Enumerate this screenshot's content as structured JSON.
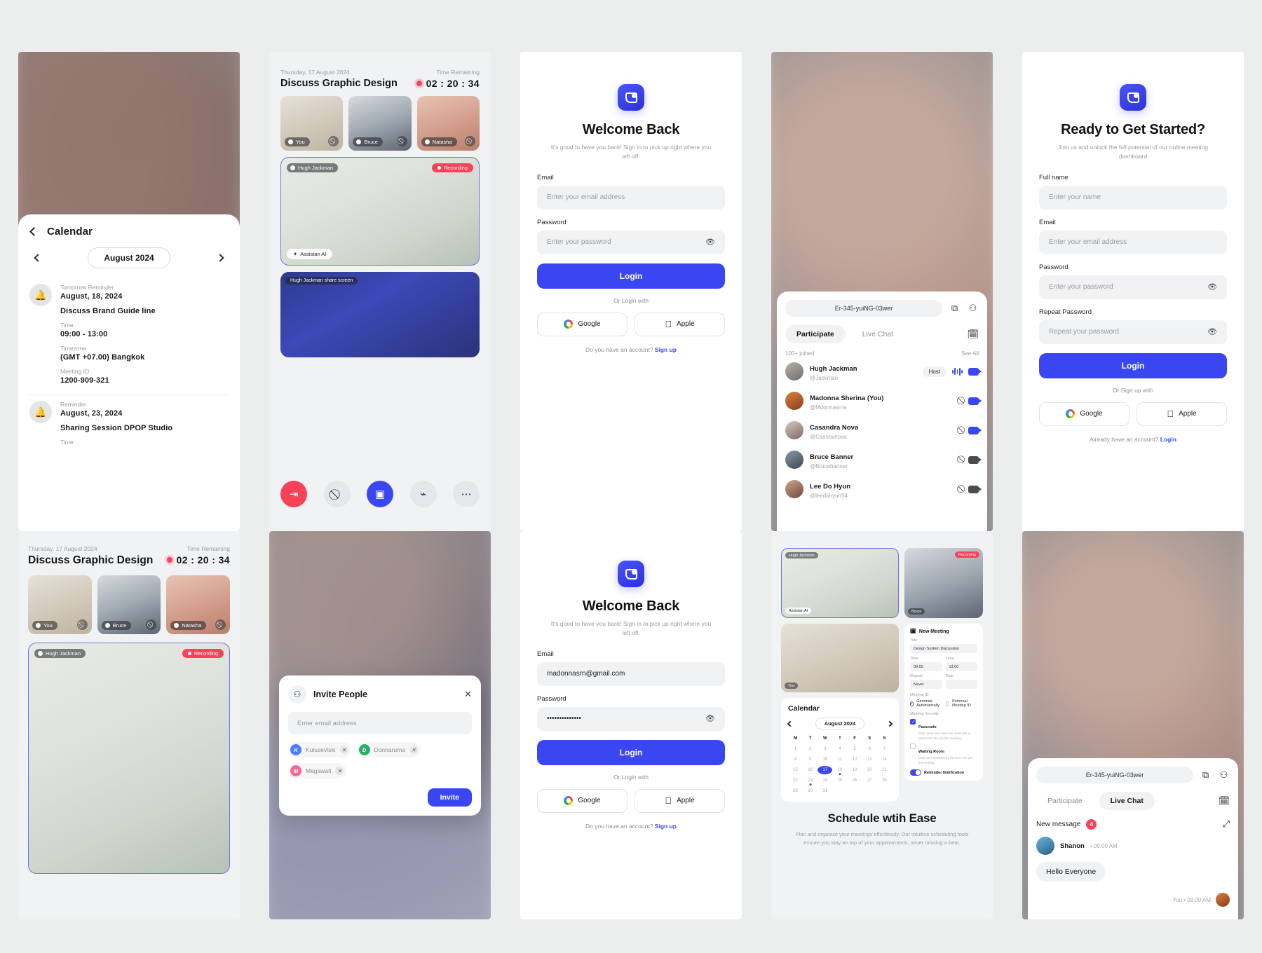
{
  "calendar_screen": {
    "back_label": "Calendar",
    "month": "August 2024",
    "events": [
      {
        "reminder_label": "Tomorrow Reminder",
        "date": "August, 18, 2024",
        "title": "Discuss Brand Guide line",
        "time_label": "Time",
        "time": "09:00 - 13:00",
        "tz_label": "Timezone",
        "tz": "(GMT +07.00) Bangkok",
        "id_label": "Meeting ID",
        "id": "1200-909-321"
      },
      {
        "reminder_label": "Reminder",
        "date": "August, 23, 2024",
        "title": "Sharing Session DPOP Studio",
        "time_label": "Time"
      }
    ]
  },
  "meeting_screen": {
    "date": "Thursday, 17 August 2024",
    "title": "Discuss Graphic Design",
    "remaining_label": "Time Remaining",
    "remaining": "02 : 20 : 34",
    "thumbs": [
      {
        "name": "You"
      },
      {
        "name": "Bruce"
      },
      {
        "name": "Natasha"
      }
    ],
    "stage_name": "Hugh Jackman",
    "recording_label": "Recording",
    "assistant_label": "Assistan AI",
    "share_label": "Hugh Jackman share screen",
    "controls": [
      "leave",
      "mic-off",
      "camera",
      "cast",
      "more"
    ]
  },
  "login_screen": {
    "heading": "Welcome Back",
    "sub": "It's good to have you back! Sign in to pick up right where you left off.",
    "email_label": "Email",
    "email_placeholder": "Enter your email address",
    "password_label": "Password",
    "password_placeholder": "Enter your password",
    "login_button": "Login",
    "or_label": "Or Login with",
    "google": "Google",
    "apple": "Apple",
    "footnote_q": "Do you have an account?",
    "footnote_link": "Sign up"
  },
  "login_filled_screen": {
    "heading": "Welcome Back",
    "sub": "It's good to have you back! Sign in to pick up right where you left off.",
    "email_label": "Email",
    "email_value": "madonnasrn@gmail.com",
    "password_label": "Password",
    "password_value": "••••••••••••••",
    "login_button": "Login",
    "or_label": "Or Login with",
    "google": "Google",
    "apple": "Apple",
    "footnote_q": "Do you have an account?",
    "footnote_link": "Sign up"
  },
  "signup_screen": {
    "heading": "Ready to Get Started?",
    "sub": "Join us and unlock the full potential of our online meeting dashboard",
    "name_label": "Full name",
    "name_placeholder": "Enter your name",
    "email_label": "Email",
    "email_placeholder": "Enter your email address",
    "password_label": "Password",
    "password_placeholder": "Enter your password",
    "repeat_label": "Repeat Password",
    "repeat_placeholder": "Repeat your password",
    "login_button": "Login",
    "or_label": "Or Sign up with",
    "google": "Google",
    "apple": "Apple",
    "footnote_q": "Already have an account?",
    "footnote_link": "Login"
  },
  "participants_screen": {
    "meeting_id": "Er-345-yuiNG-03wer",
    "tab_participate": "Participate",
    "tab_livechat": "Live Chat",
    "joined": "100+ joined",
    "see_all": "See All",
    "people": [
      {
        "name": "Hugh Jackman",
        "handle": "@Jackman",
        "badge": "Host",
        "mic": "wave",
        "cam": "on"
      },
      {
        "name": "Madonna Sherina (You)",
        "handle": "@Mdonnasrna",
        "badge": "",
        "mic": "off",
        "cam": "on"
      },
      {
        "name": "Casandra Nova",
        "handle": "@Casnovnova",
        "badge": "",
        "mic": "off",
        "cam": "on"
      },
      {
        "name": "Bruce Banner",
        "handle": "@Brucebanner",
        "badge": "",
        "mic": "off",
        "cam": "off"
      },
      {
        "name": "Lee Do Hyun",
        "handle": "@leedohyun54",
        "badge": "",
        "mic": "off",
        "cam": "off"
      }
    ]
  },
  "invite_dialog": {
    "title": "Invite People",
    "input_placeholder": "Enter email address",
    "chips": [
      {
        "initial": "K",
        "name": "Kuluseviski",
        "color": "#4f7ff5"
      },
      {
        "initial": "D",
        "name": "Donnaruma",
        "color": "#2fae6a"
      },
      {
        "initial": "M",
        "name": "Megawati",
        "color": "#f16a9d"
      }
    ],
    "invite_button": "Invite"
  },
  "dashboard_screen": {
    "tile_names": [
      "Hugh Jackman",
      "Bruce",
      "You"
    ],
    "assistant_label": "Assistan AI",
    "recording_label": "Recording",
    "calendar_title": "Calendar",
    "calendar_month": "August 2024",
    "weekday_headers": [
      "M",
      "T",
      "W",
      "T",
      "F",
      "S",
      "S"
    ],
    "new_meeting_title": "New Meeting",
    "title_label": "Title",
    "title_value": "Design System Discussion",
    "time_label": "Time",
    "time_from": "09.00",
    "time_to": "13.00",
    "date_label": "Date",
    "repeat_label": "Repeat",
    "repeat_value": "Never",
    "meeting_id_label": "Meeting ID",
    "generate_auto": "Generate Automatically",
    "personal_id": "Personal Meeting ID",
    "security_label": "Meeting Security",
    "passcode_label": "Passcode",
    "passcode_desc": "Only users who have the invite link or passcode can join the meeting.",
    "waiting_room_label": "Waiting Room",
    "waiting_room_desc": "Only user admitted by the host can join the meeting",
    "reminder_label": "Reminder Notification",
    "hero_title": "Schedule wtih Ease",
    "hero_sub": "Plan and organize your meetings effortlessly. Our intuitive scheduling tools ensure you stay on top of your appointments, never missing a beat."
  },
  "livechat_screen": {
    "meeting_id": "Er-345-yuiNG-03wer",
    "tab_participate": "Participate",
    "tab_livechat": "Live Chat",
    "new_message_label": "New message",
    "new_message_count": "4",
    "sender": "Shanon",
    "sender_time": "09.00 AM",
    "message": "Hello Everyone",
    "you_label": "You",
    "you_time": "09.00 AM"
  },
  "colors": {
    "accent": "#3a46f2",
    "danger": "#f8425a",
    "bg": "#eceded",
    "field": "#f1f2f4"
  }
}
